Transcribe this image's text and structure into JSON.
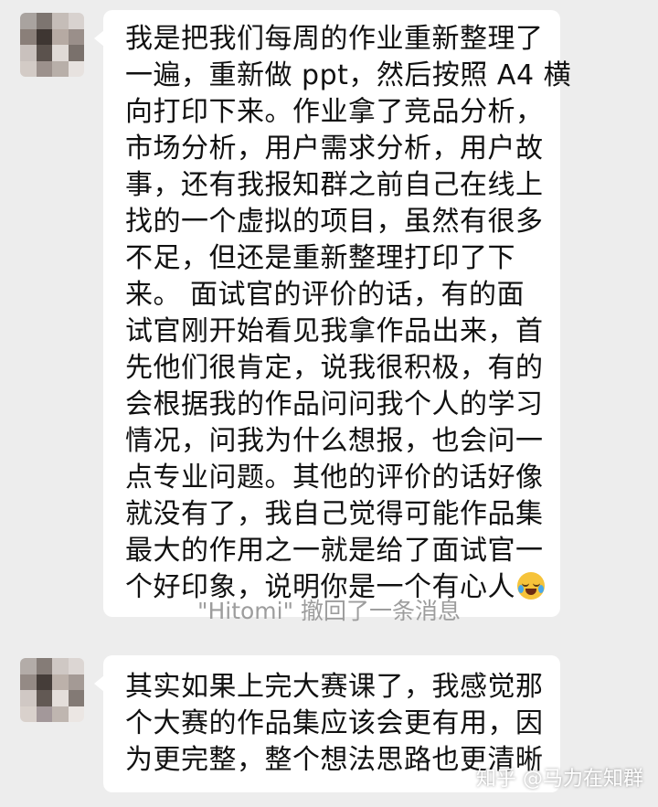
{
  "messages": [
    {
      "sender": "other",
      "avatar_icon": "pixelated-avatar",
      "lines": [
        "我是把我们每周的作业重新整理了",
        "一遍，重新做 ppt，然后按照 A4 横",
        "向打印下来。作业拿了竞品分析，",
        "市场分析，用户需求分析，用户故",
        "事，还有我报知群之前自己在线上",
        "找的一个虚拟的项目，虽然有很多",
        "不足，但还是重新整理打印了下",
        "来。 面试官的评价的话，有的面",
        "试官刚开始看见我拿作品出来，首",
        "先他们很肯定，说我很积极，有的",
        "会根据我的作品问问我个人的学习",
        "情况，问我为什么想报，也会问一",
        "点专业问题。其他的评价的话好像",
        "就没有了，我自己觉得可能作品集",
        "最大的作用之一就是给了面试官一",
        "个好印象，说明你是一个有心人"
      ],
      "trailing_emoji": "crying-laughing-emoji"
    },
    {
      "sender": "other",
      "avatar_icon": "pixelated-avatar",
      "lines": [
        "其实如果上完大赛课了，我感觉那",
        "个大赛的作品集应该会更有用，因",
        "为更完整，整个想法思路也更清晰"
      ]
    }
  ],
  "system_note": "\"Hitomi\" 撤回了一条消息",
  "watermark": "知乎 @马力在知群",
  "colors": {
    "background": "#ededed",
    "bubble": "#ffffff",
    "text": "#111111",
    "system_text": "#9d9d9d"
  }
}
